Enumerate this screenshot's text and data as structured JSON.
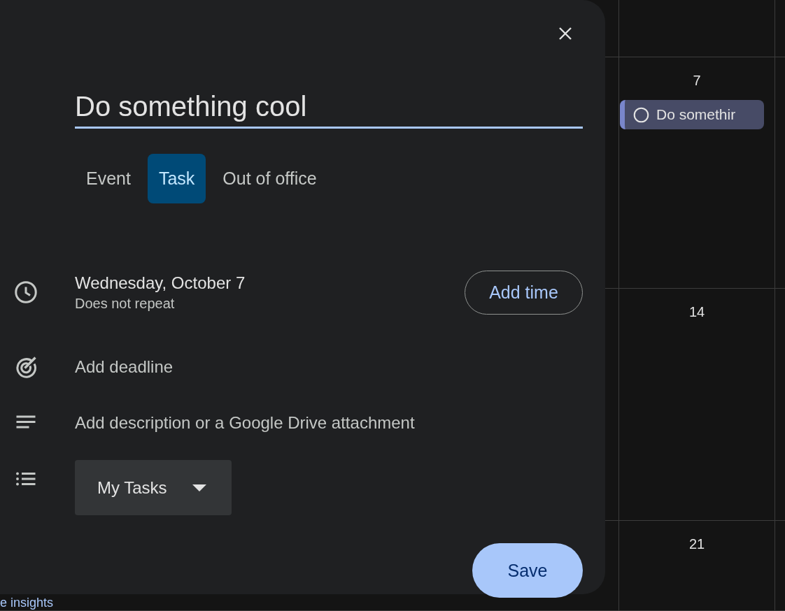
{
  "background_link": "e insights",
  "calendar": {
    "days": [
      {
        "date": "7",
        "event": {
          "title": "Do somethir",
          "completed": false,
          "color": "#7986cb"
        }
      },
      {
        "date": "14"
      },
      {
        "date": "21"
      }
    ]
  },
  "dialog": {
    "title_field": {
      "value": "Do something cool"
    },
    "tabs": [
      {
        "label": "Event",
        "selected": false
      },
      {
        "label": "Task",
        "selected": true
      },
      {
        "label": "Out of office",
        "selected": false
      }
    ],
    "date": "Wednesday, October 7",
    "repeat": "Does not repeat",
    "add_time_button": "Add time",
    "deadline": "Add deadline",
    "description": "Add description or a Google Drive attachment",
    "task_list": {
      "value": "My Tasks"
    },
    "save_button": "Save"
  }
}
